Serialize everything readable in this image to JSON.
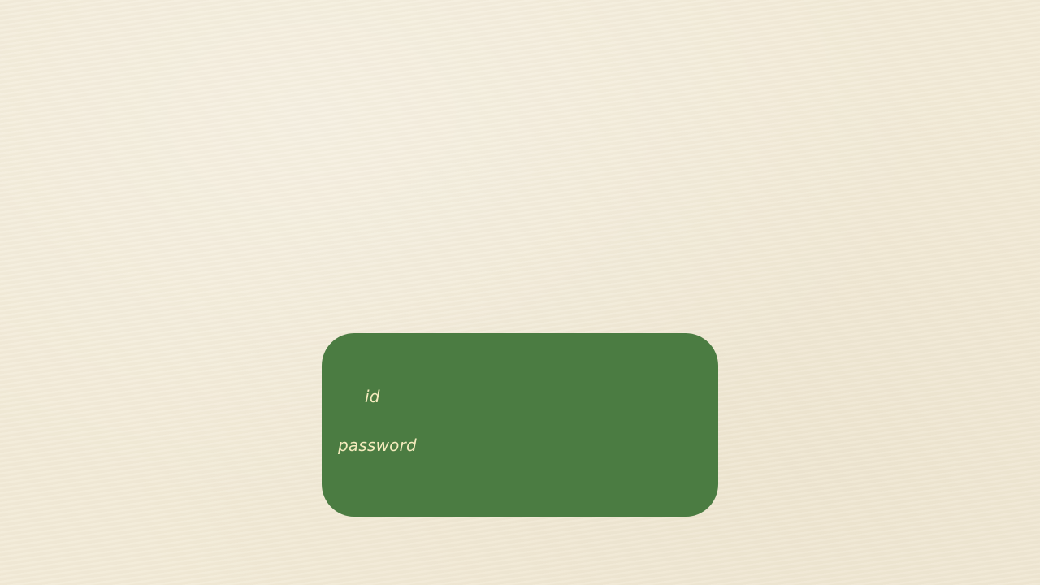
{
  "login": {
    "id_label": "id",
    "password_label": "password",
    "id_value": "",
    "password_value": ""
  },
  "colors": {
    "background": "#f2ead6",
    "panel": "#4b7c42",
    "label_text": "#f4ebbd"
  }
}
